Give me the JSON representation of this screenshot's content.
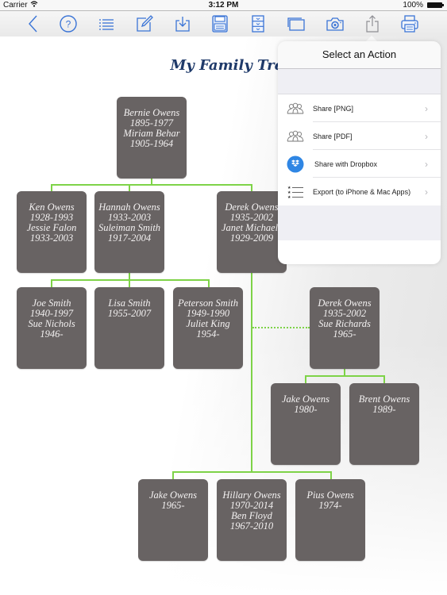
{
  "status_bar": {
    "carrier": "Carrier",
    "wifi_icon": "wifi-icon",
    "time": "3:12 PM",
    "battery_percent": "100%"
  },
  "toolbar": {
    "buttons": [
      {
        "name": "back",
        "icon": "chevron-left-icon"
      },
      {
        "name": "help",
        "icon": "question-circle-icon",
        "glyph": "?"
      },
      {
        "name": "list",
        "icon": "list-icon"
      },
      {
        "name": "edit",
        "icon": "pencil-square-icon"
      },
      {
        "name": "import",
        "icon": "download-tray-icon"
      },
      {
        "name": "save",
        "icon": "floppy-disk-icon"
      },
      {
        "name": "file-cabinet",
        "icon": "file-cabinet-icon"
      },
      {
        "name": "windows",
        "icon": "stacked-windows-icon"
      },
      {
        "name": "camera",
        "icon": "camera-icon"
      },
      {
        "name": "share",
        "icon": "share-icon"
      },
      {
        "name": "print",
        "icon": "printer-icon"
      }
    ],
    "accent_color": "#3a74d6",
    "active_color": "#8e8e93"
  },
  "tree": {
    "title": "My Family Tree",
    "box_color": "#686363",
    "line_color": "#7ed348",
    "people": {
      "bernie": [
        "Bernie Owens",
        "1895-1977",
        "Miriam Behar",
        "1905-1964"
      ],
      "ken": [
        "Ken Owens",
        "1928-1993",
        "Jessie Falon",
        "1933-2003"
      ],
      "hannah": [
        "Hannah Owens",
        "1933-2003",
        "Suleiman Smith",
        "1917-2004"
      ],
      "derek": [
        "Derek Owens",
        "1935-2002",
        "Janet Michaels",
        "1929-2009"
      ],
      "joe": [
        "Joe Smith",
        "1940-1997",
        "Sue Nichols",
        "1946-"
      ],
      "lisa": [
        "Lisa Smith",
        "1955-2007"
      ],
      "peterson": [
        "Peterson Smith",
        "1949-1990",
        "Juliet King",
        "1954-"
      ],
      "derek2": [
        "Derek Owens",
        "1935-2002",
        "Sue Richards",
        "1965-"
      ],
      "jake_1980": [
        "Jake Owens",
        "1980-"
      ],
      "brent": [
        "Brent Owens",
        "1989-"
      ],
      "jake_1965": [
        "Jake Owens",
        "1965-"
      ],
      "hillary": [
        "Hillary Owens",
        "1970-2014",
        "Ben Floyd",
        "1967-2010"
      ],
      "pius": [
        "Pius Owens",
        "1974-"
      ]
    }
  },
  "action_popover": {
    "title": "Select an Action",
    "items": [
      {
        "label": "Share [PNG]",
        "icon": "people-group-icon"
      },
      {
        "label": "Share [PDF]",
        "icon": "people-group-icon"
      },
      {
        "label": "Share with Dropbox",
        "icon": "dropbox-icon"
      },
      {
        "label": "Export (to iPhone & Mac Apps)",
        "icon": "starred-list-icon"
      }
    ],
    "chevron": "›",
    "dropbox_color": "#2f86e4"
  }
}
